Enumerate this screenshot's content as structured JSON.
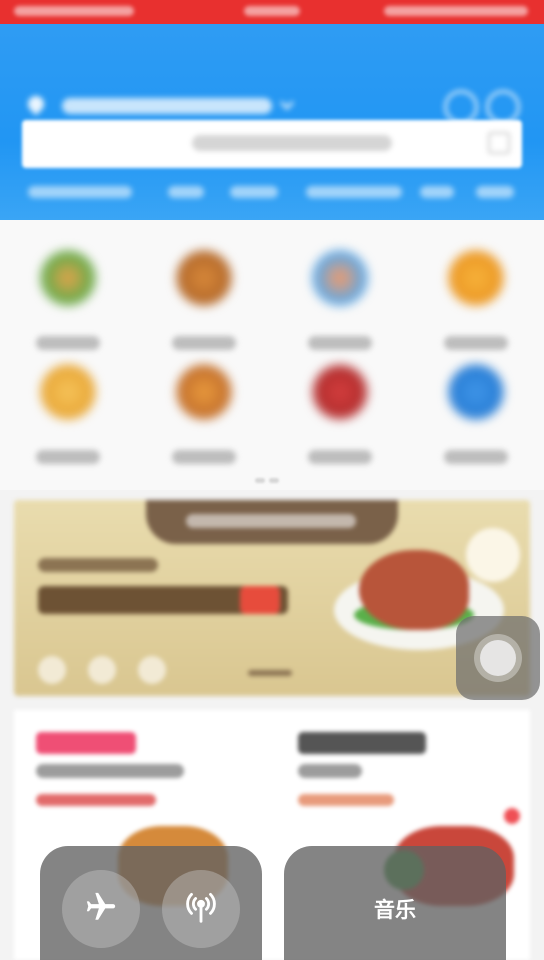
{
  "status_bar": {
    "background": "#e8302f"
  },
  "header": {
    "background": "#2196f3",
    "icons": {
      "location": "location-pin-icon",
      "user": "user-icon",
      "message": "message-icon",
      "scan": "scan-icon"
    }
  },
  "category_icons": [
    "food-icon-1",
    "food-icon-2",
    "food-icon-3",
    "food-icon-4",
    "food-icon-5",
    "food-icon-6",
    "food-icon-7",
    "food-icon-8"
  ],
  "banner": {
    "accent": "#7a6149"
  },
  "assistive_touch": {
    "icon": "assistive-touch-icon"
  },
  "control_center": {
    "airplane_icon": "airplane-icon",
    "cellular_icon": "cellular-antenna-icon",
    "music_label": "音乐"
  }
}
